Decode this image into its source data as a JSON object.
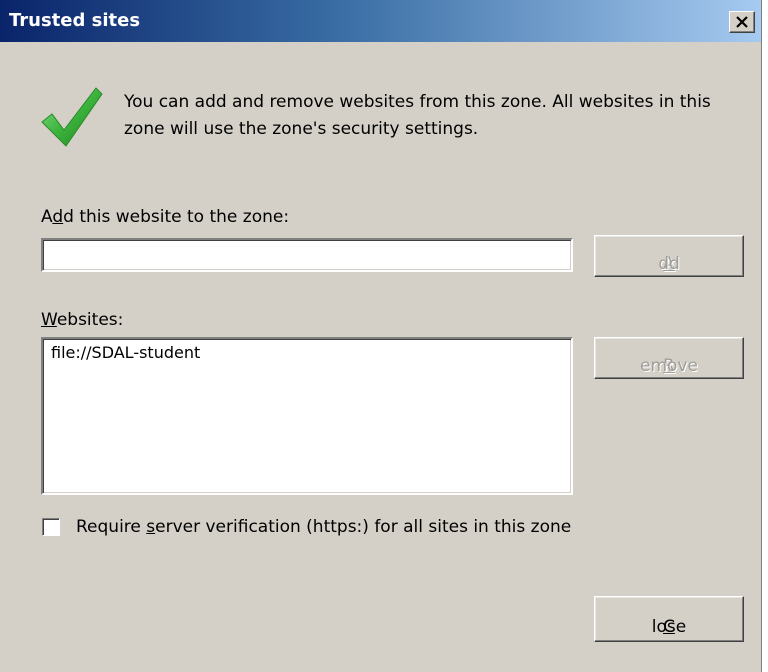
{
  "window": {
    "title": "Trusted sites"
  },
  "info": {
    "text": "You can add and remove websites from this zone. All websites in this zone will use the zone's security settings."
  },
  "add_section": {
    "label_pre": "A",
    "label_key": "d",
    "label_post": "d this website to the zone:",
    "input_value": "",
    "add_pre": "",
    "add_key": "A",
    "add_post": "dd"
  },
  "websites_section": {
    "label_pre": "",
    "label_key": "W",
    "label_post": "ebsites:",
    "items": [
      "file://SDAL-student"
    ],
    "remove_pre": "",
    "remove_key": "R",
    "remove_post": "emove"
  },
  "verification": {
    "checked": false,
    "label_pre": "Require ",
    "label_key": "s",
    "label_post": "erver verification (https:) for all sites in this zone"
  },
  "close_button": {
    "pre": "",
    "key": "C",
    "post": "lose"
  },
  "icons": {
    "check": "checkmark-icon",
    "close": "close-icon",
    "check_color": "#3cb43c"
  }
}
